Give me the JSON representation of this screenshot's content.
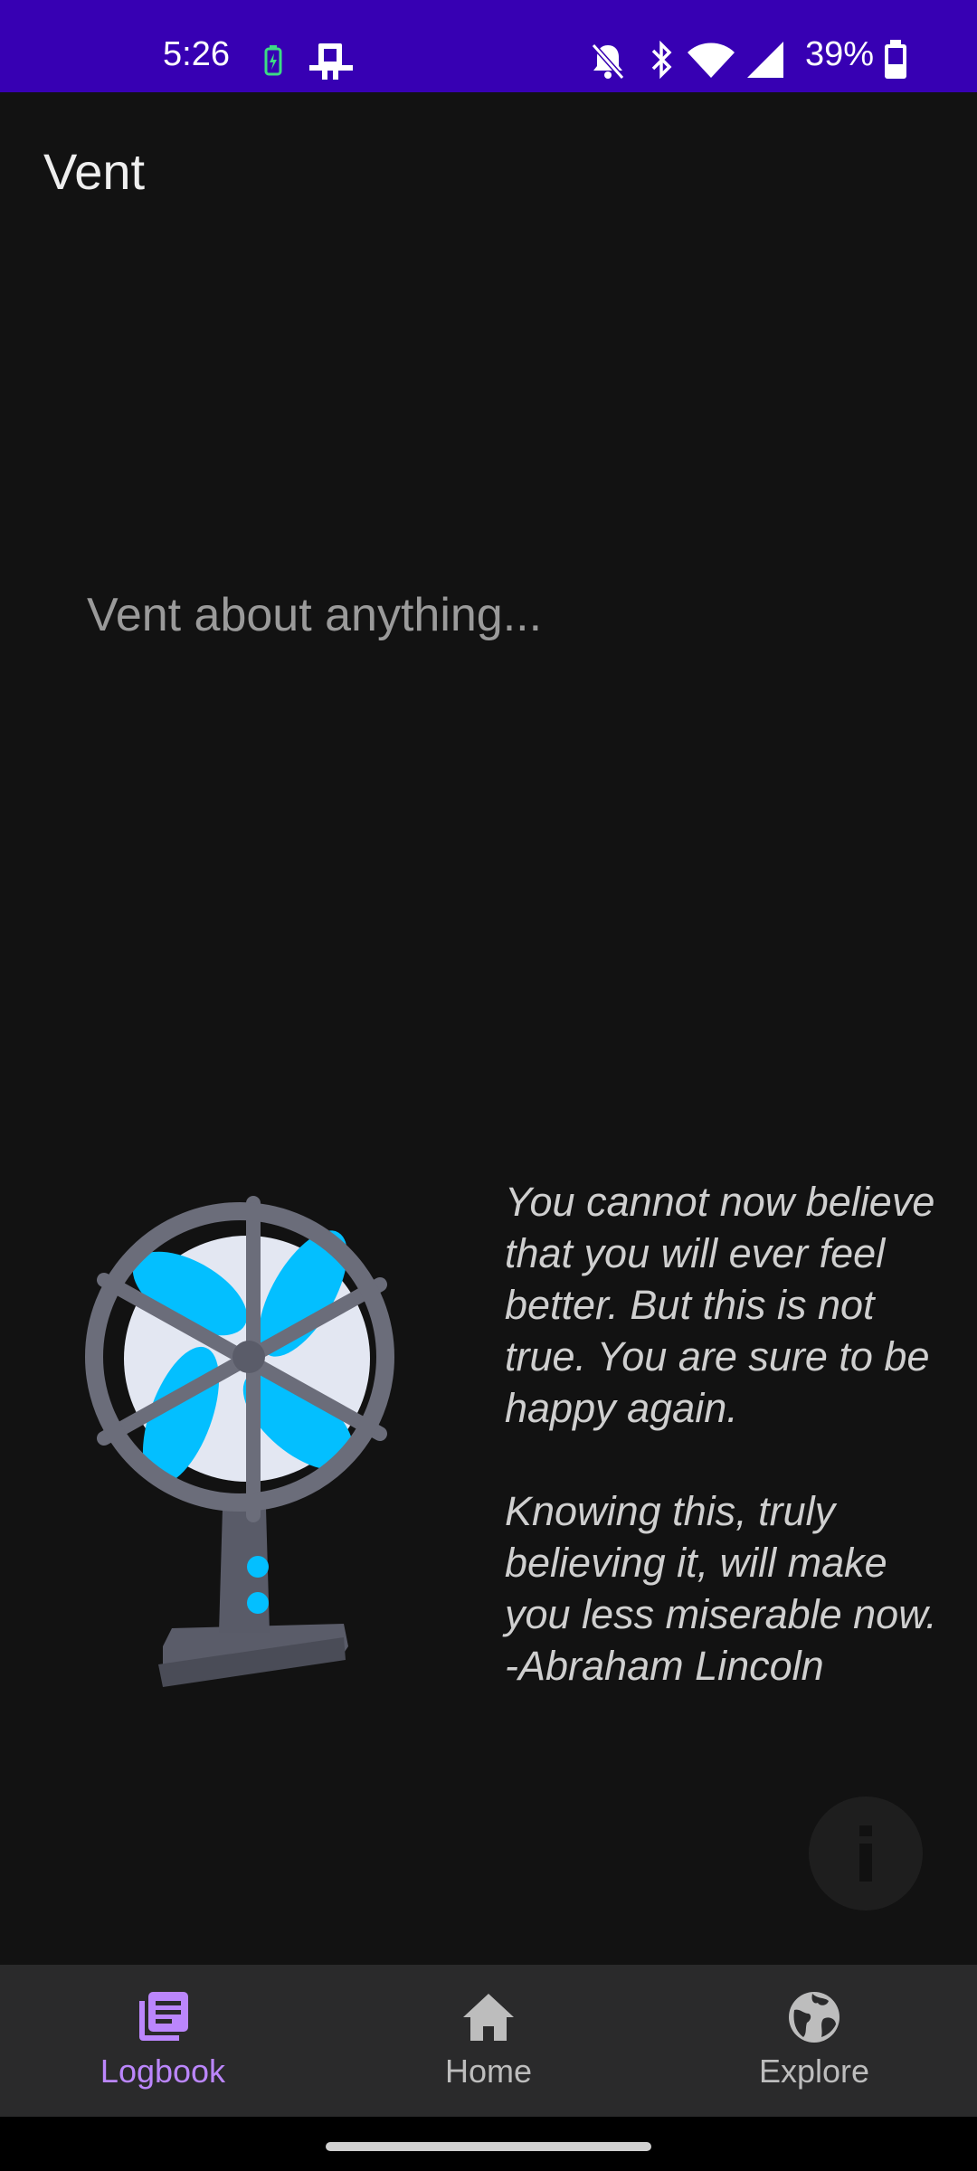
{
  "status_bar": {
    "time": "5:26",
    "battery": "39%",
    "icons": [
      "battery-charging-icon",
      "cast-icon",
      "do-not-disturb-icon",
      "bluetooth-icon",
      "wifi-icon",
      "cell-signal-icon",
      "battery-icon"
    ]
  },
  "app_bar": {
    "title": "Vent"
  },
  "vent": {
    "placeholder": "Vent about anything...",
    "value": ""
  },
  "quote": {
    "paragraph1": "You cannot now believe that you will ever feel better. But this is not true. You are sure to be happy again.",
    "paragraph2": "Knowing this, truly believing it, will make you less miserable now.",
    "author": "-Abraham Lincoln"
  },
  "info_button": {
    "icon": "info-icon"
  },
  "bottom_nav": {
    "items": [
      {
        "label": "Logbook",
        "icon": "logbook-icon",
        "active": true
      },
      {
        "label": "Home",
        "icon": "home-icon",
        "active": false
      },
      {
        "label": "Explore",
        "icon": "globe-icon",
        "active": false
      }
    ]
  },
  "colors": {
    "status_bar": "#3700B3",
    "background": "#121212",
    "nav_background": "#2a2a2b",
    "accent": "#BB86FC",
    "fan_blade": "#03BFFF"
  }
}
